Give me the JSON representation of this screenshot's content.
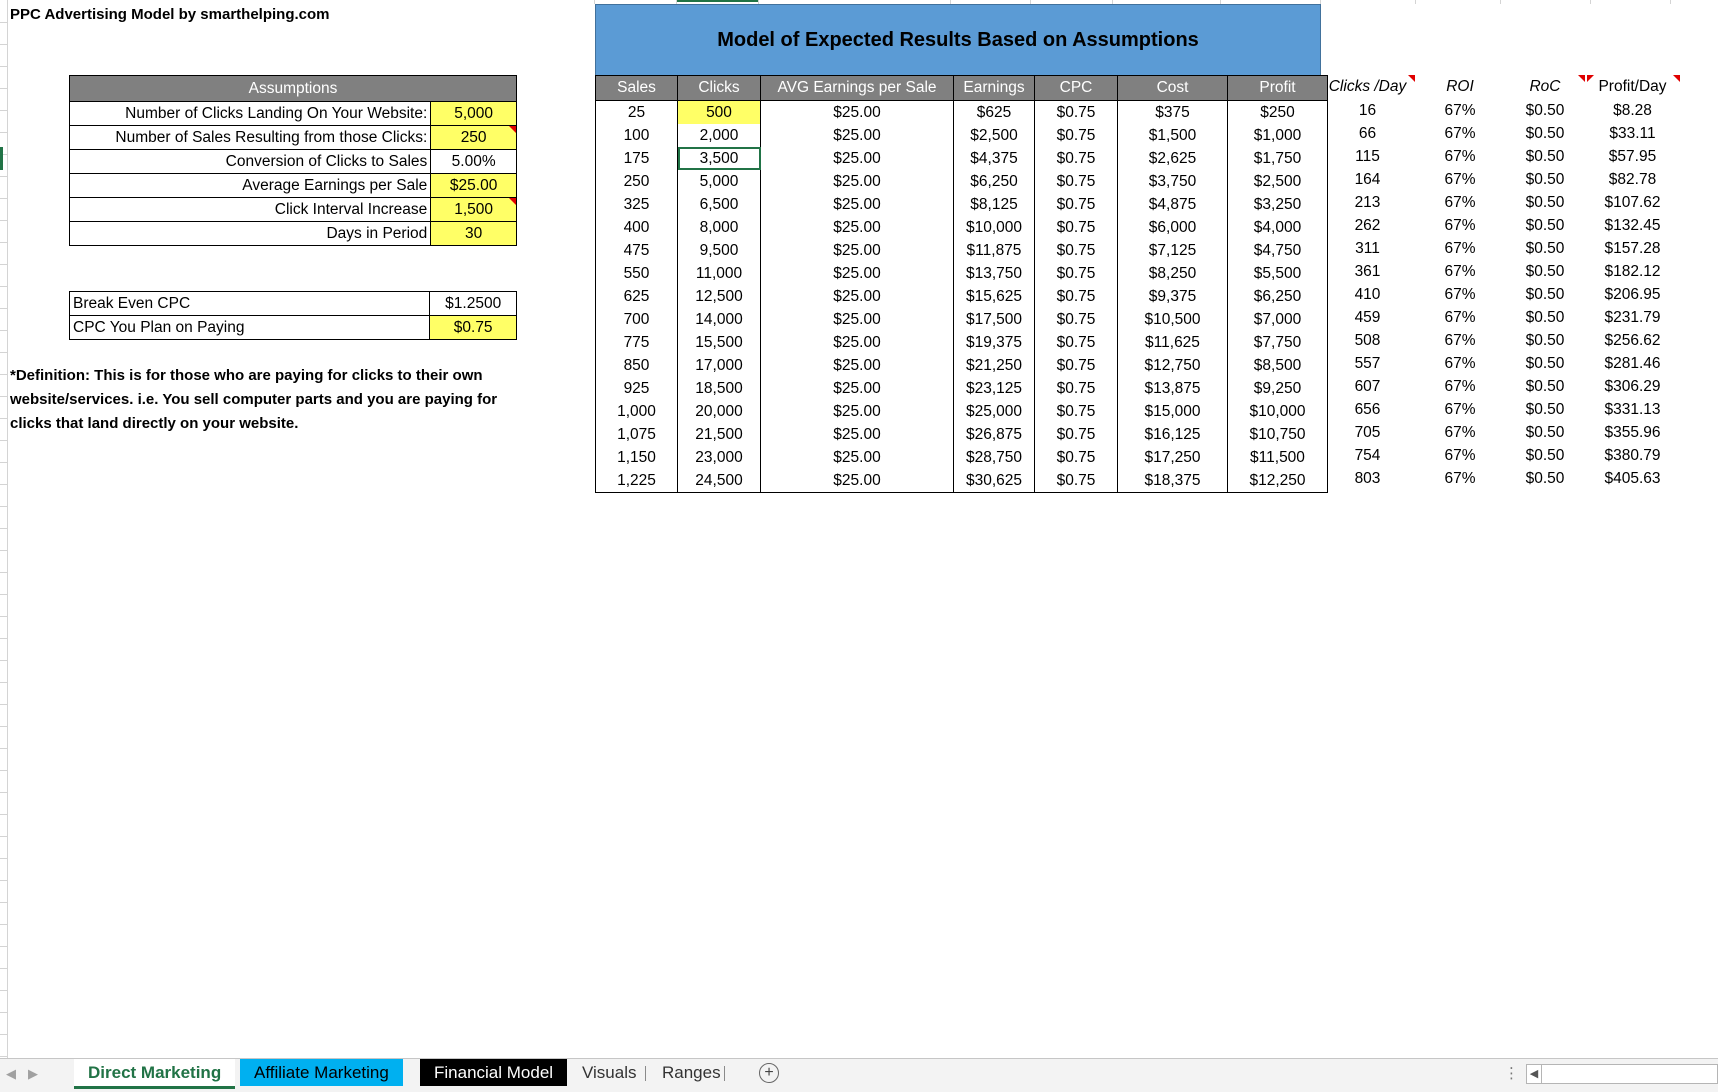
{
  "title": "PPC Advertising Model by smarthelping.com",
  "assumptions": {
    "header": "Assumptions",
    "rows": [
      {
        "label": "Number of Clicks Landing On Your Website:",
        "value": "5,000"
      },
      {
        "label": "Number of Sales Resulting from those Clicks:",
        "value": "250"
      },
      {
        "label": "Conversion of Clicks to Sales",
        "value": "5.00%"
      },
      {
        "label": "Average Earnings per Sale",
        "value": "$25.00"
      },
      {
        "label": "Click Interval Increase",
        "value": "1,500"
      },
      {
        "label": "Days in Period",
        "value": "30"
      }
    ]
  },
  "breakeven": {
    "rows": [
      {
        "label": "Break Even CPC",
        "value": "$1.2500"
      },
      {
        "label": "CPC You Plan on Paying",
        "value": "$0.75"
      }
    ]
  },
  "definition": "*Definition: This is for those who are paying for clicks to their own website/services. i.e. You sell computer parts and you are paying for clicks that land directly on your website.",
  "model": {
    "banner": "Model of Expected Results Based on Assumptions",
    "headers": [
      "Sales",
      "Clicks",
      "AVG Earnings per Sale",
      "Earnings",
      "CPC",
      "Cost",
      "Profit"
    ],
    "rows": [
      [
        "25",
        "500",
        "$25.00",
        "$625",
        "$0.75",
        "$375",
        "$250"
      ],
      [
        "100",
        "2,000",
        "$25.00",
        "$2,500",
        "$0.75",
        "$1,500",
        "$1,000"
      ],
      [
        "175",
        "3,500",
        "$25.00",
        "$4,375",
        "$0.75",
        "$2,625",
        "$1,750"
      ],
      [
        "250",
        "5,000",
        "$25.00",
        "$6,250",
        "$0.75",
        "$3,750",
        "$2,500"
      ],
      [
        "325",
        "6,500",
        "$25.00",
        "$8,125",
        "$0.75",
        "$4,875",
        "$3,250"
      ],
      [
        "400",
        "8,000",
        "$25.00",
        "$10,000",
        "$0.75",
        "$6,000",
        "$4,000"
      ],
      [
        "475",
        "9,500",
        "$25.00",
        "$11,875",
        "$0.75",
        "$7,125",
        "$4,750"
      ],
      [
        "550",
        "11,000",
        "$25.00",
        "$13,750",
        "$0.75",
        "$8,250",
        "$5,500"
      ],
      [
        "625",
        "12,500",
        "$25.00",
        "$15,625",
        "$0.75",
        "$9,375",
        "$6,250"
      ],
      [
        "700",
        "14,000",
        "$25.00",
        "$17,500",
        "$0.75",
        "$10,500",
        "$7,000"
      ],
      [
        "775",
        "15,500",
        "$25.00",
        "$19,375",
        "$0.75",
        "$11,625",
        "$7,750"
      ],
      [
        "850",
        "17,000",
        "$25.00",
        "$21,250",
        "$0.75",
        "$12,750",
        "$8,500"
      ],
      [
        "925",
        "18,500",
        "$25.00",
        "$23,125",
        "$0.75",
        "$13,875",
        "$9,250"
      ],
      [
        "1,000",
        "20,000",
        "$25.00",
        "$25,000",
        "$0.75",
        "$15,000",
        "$10,000"
      ],
      [
        "1,075",
        "21,500",
        "$25.00",
        "$26,875",
        "$0.75",
        "$16,125",
        "$10,750"
      ],
      [
        "1,150",
        "23,000",
        "$25.00",
        "$28,750",
        "$0.75",
        "$17,250",
        "$11,500"
      ],
      [
        "1,225",
        "24,500",
        "$25.00",
        "$30,625",
        "$0.75",
        "$18,375",
        "$12,250"
      ]
    ]
  },
  "extra": {
    "headers": [
      "Clicks /Day",
      "ROI",
      "RoC",
      "Profit/Day"
    ],
    "rows": [
      [
        "16",
        "67%",
        "$0.50",
        "$8.28"
      ],
      [
        "66",
        "67%",
        "$0.50",
        "$33.11"
      ],
      [
        "115",
        "67%",
        "$0.50",
        "$57.95"
      ],
      [
        "164",
        "67%",
        "$0.50",
        "$82.78"
      ],
      [
        "213",
        "67%",
        "$0.50",
        "$107.62"
      ],
      [
        "262",
        "67%",
        "$0.50",
        "$132.45"
      ],
      [
        "311",
        "67%",
        "$0.50",
        "$157.28"
      ],
      [
        "361",
        "67%",
        "$0.50",
        "$182.12"
      ],
      [
        "410",
        "67%",
        "$0.50",
        "$206.95"
      ],
      [
        "459",
        "67%",
        "$0.50",
        "$231.79"
      ],
      [
        "508",
        "67%",
        "$0.50",
        "$256.62"
      ],
      [
        "557",
        "67%",
        "$0.50",
        "$281.46"
      ],
      [
        "607",
        "67%",
        "$0.50",
        "$306.29"
      ],
      [
        "656",
        "67%",
        "$0.50",
        "$331.13"
      ],
      [
        "705",
        "67%",
        "$0.50",
        "$355.96"
      ],
      [
        "754",
        "67%",
        "$0.50",
        "$380.79"
      ],
      [
        "803",
        "67%",
        "$0.50",
        "$405.63"
      ]
    ]
  },
  "tabs": [
    {
      "label": "Direct Marketing",
      "style": "active"
    },
    {
      "label": "Affiliate Marketing",
      "style": "blue"
    },
    {
      "label": "Financial Model",
      "style": "black"
    },
    {
      "label": "Visuals",
      "style": "plain"
    },
    {
      "label": "Ranges",
      "style": "plain"
    }
  ],
  "colors": {
    "input_yellow": "#ffff66",
    "header_gray": "#808080",
    "banner_blue": "#5b9bd5",
    "excel_green": "#217346",
    "tab_blue": "#00b0f0"
  }
}
